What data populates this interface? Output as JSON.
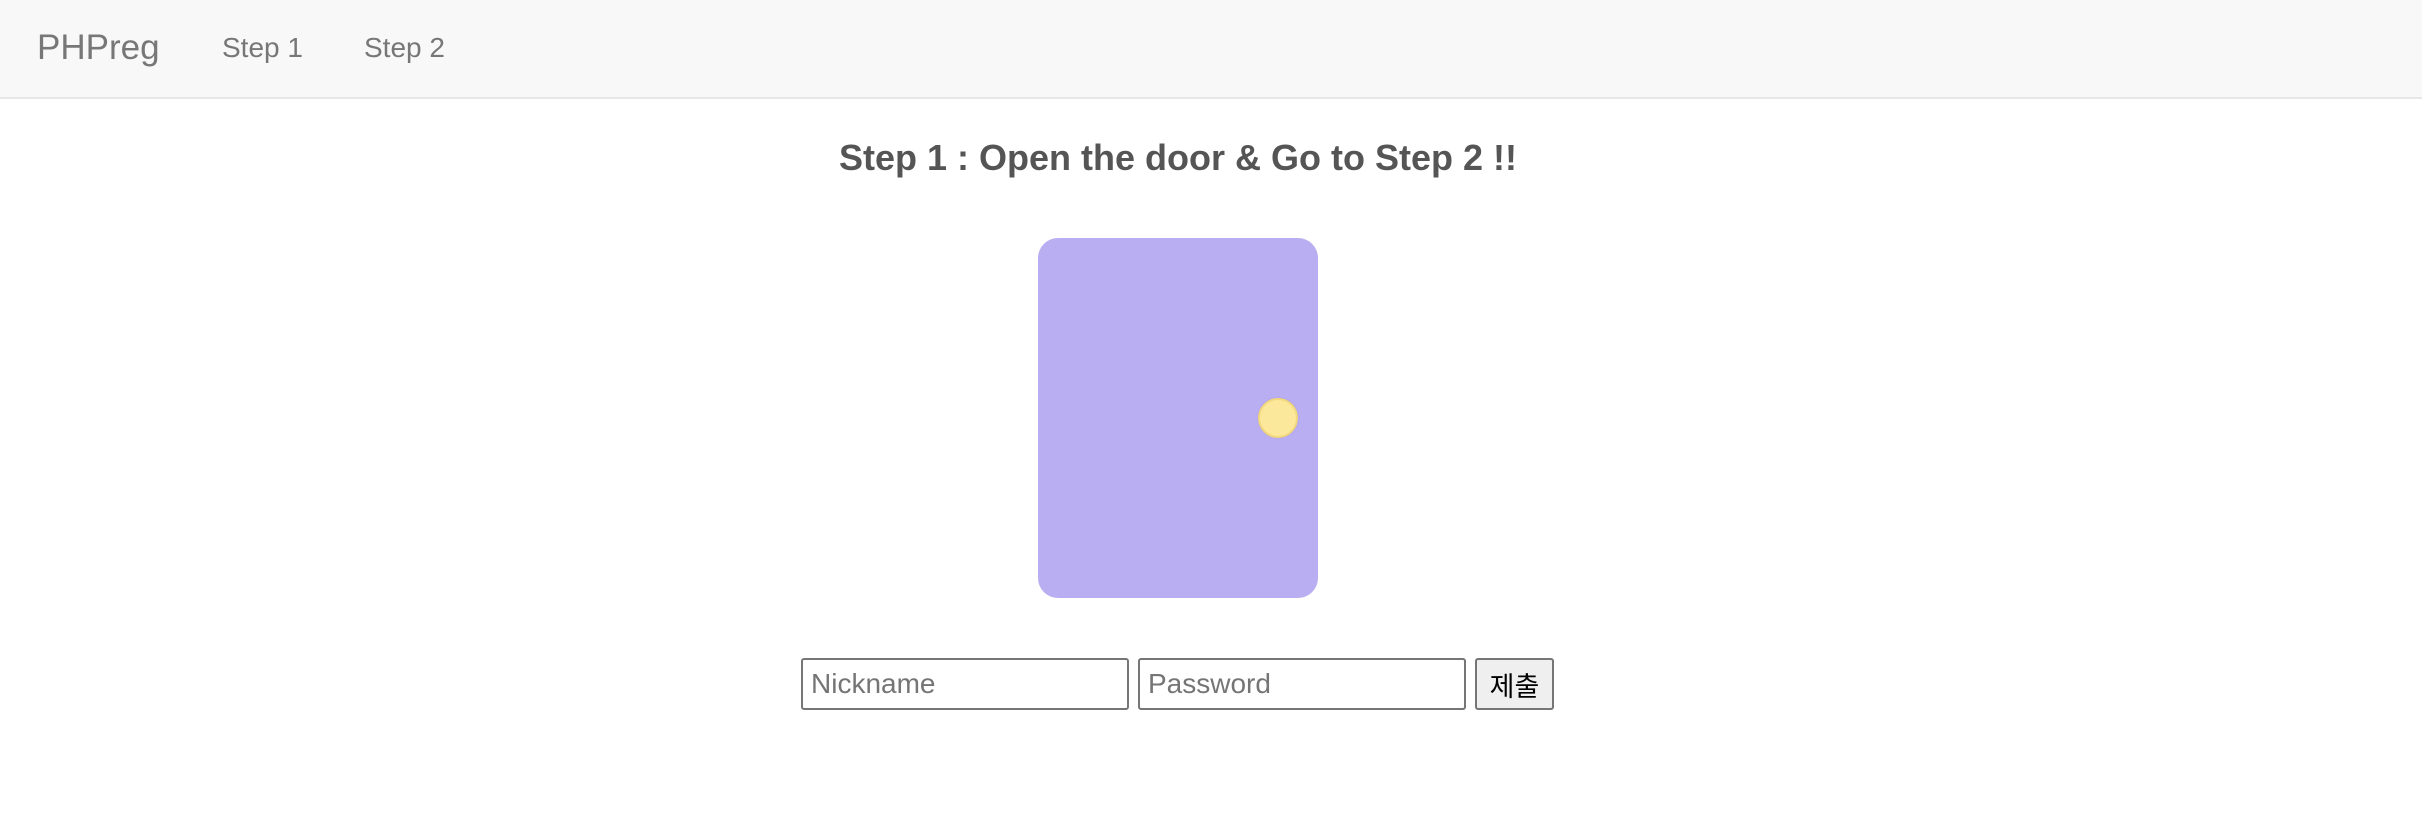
{
  "navbar": {
    "brand": "PHPreg",
    "links": [
      {
        "label": "Step 1"
      },
      {
        "label": "Step 2"
      }
    ]
  },
  "main": {
    "heading": "Step 1 : Open the door & Go to Step 2 !!",
    "door": {
      "color": "#b8aef1",
      "knob_color": "#fbe89a"
    },
    "form": {
      "nickname_placeholder": "Nickname",
      "nickname_value": "",
      "password_placeholder": "Password",
      "password_value": "",
      "submit_label": "제출"
    }
  }
}
